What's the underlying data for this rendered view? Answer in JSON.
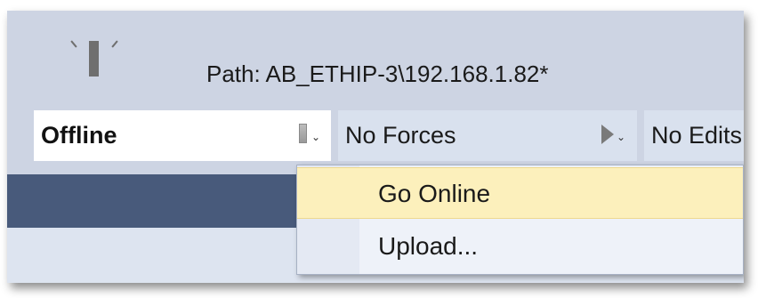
{
  "header": {
    "path_text": "Path: AB_ETHIP-3\\192.168.1.82*",
    "status_icon": "controller-status-lamp-icon"
  },
  "status_bar": {
    "mode": {
      "label": "Offline",
      "icon": "mode-indicator-icon",
      "caret": "⌄"
    },
    "forces": {
      "label": "No Forces",
      "icon": "forces-triangle-icon",
      "caret": "⌄"
    },
    "edits": {
      "label": "No Edits"
    }
  },
  "context_menu": {
    "items": [
      {
        "label": "Go Online",
        "highlighted": true
      },
      {
        "label": "Upload...",
        "highlighted": false
      }
    ]
  },
  "colors": {
    "panel_bg": "#cdd4e3",
    "dark_band": "#485a7b",
    "highlight": "#fcf0bc"
  }
}
